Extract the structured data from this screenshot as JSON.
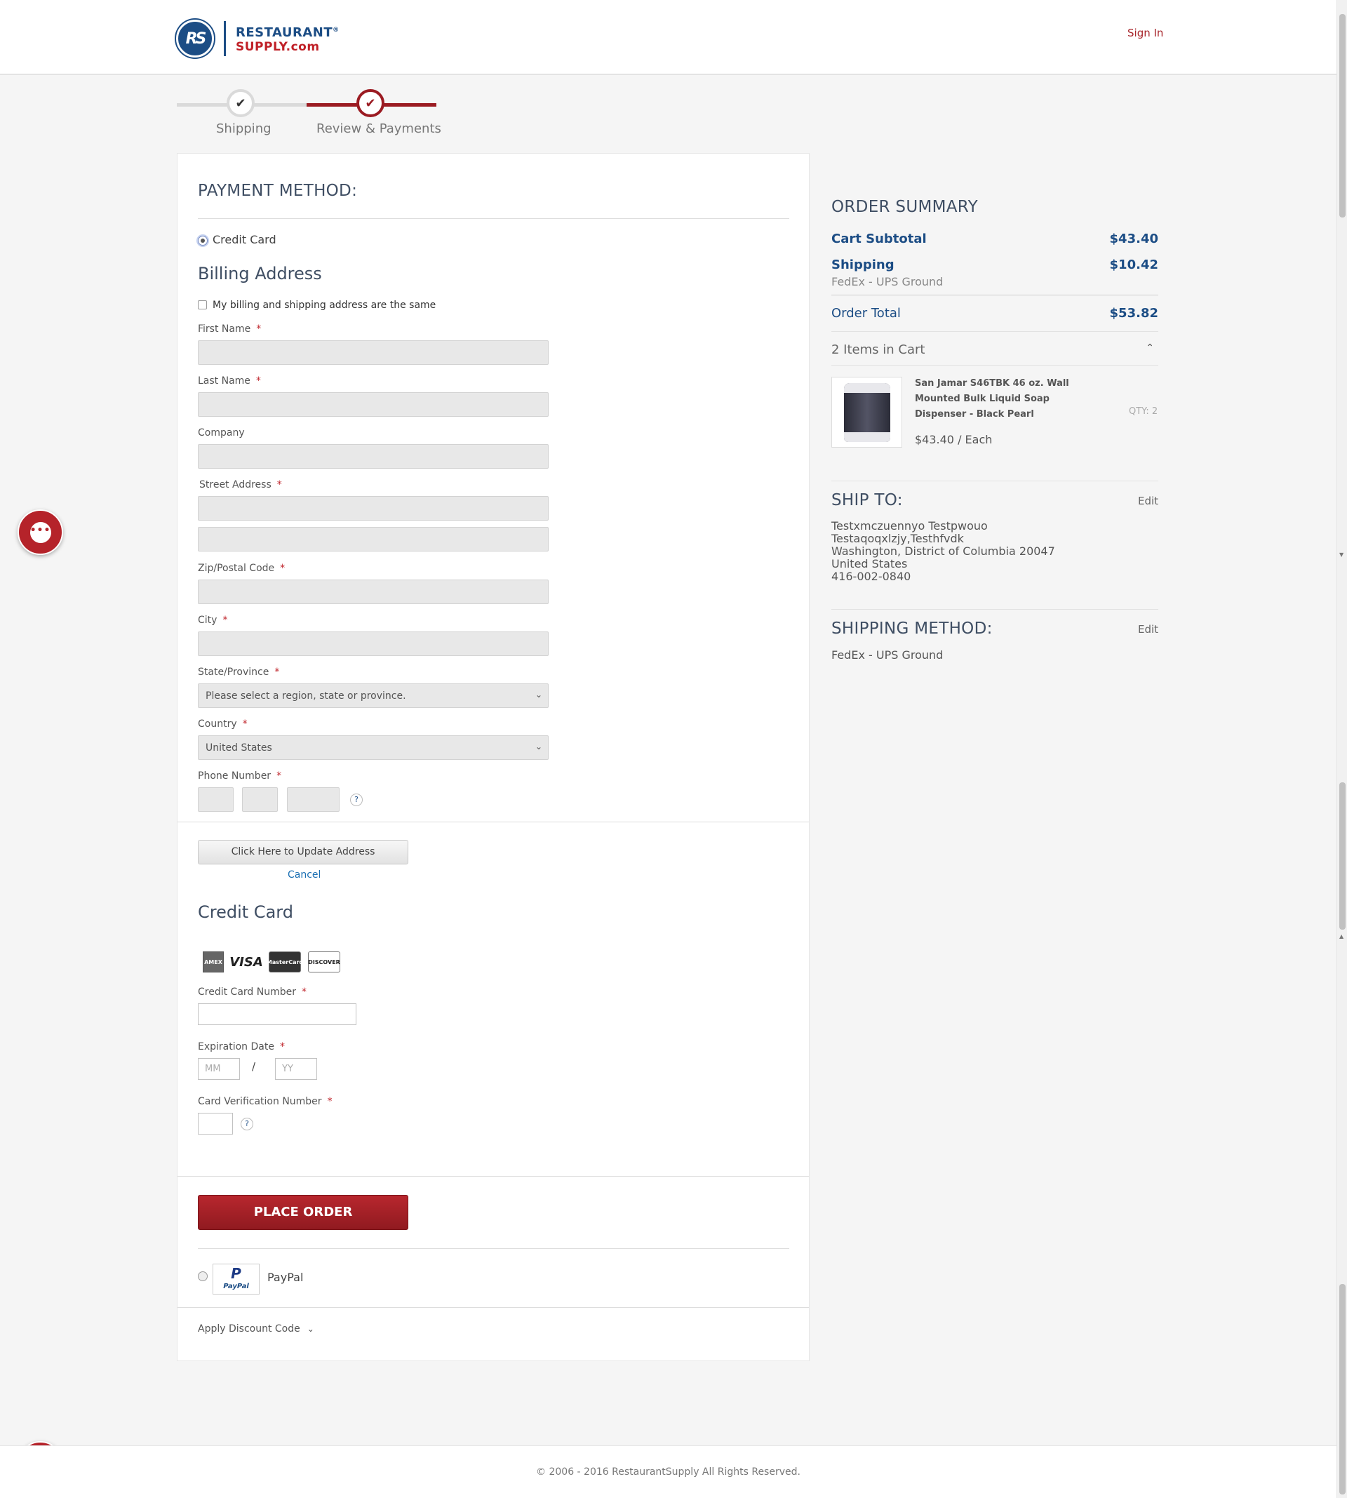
{
  "header": {
    "logo_initials": "RS",
    "logo_line1": "RESTAURANT",
    "logo_reg": "®",
    "logo_line2": "SUPPLY.com",
    "sign_in": "Sign In"
  },
  "progress": {
    "steps": [
      {
        "label": "Shipping",
        "status": "complete"
      },
      {
        "label": "Review & Payments",
        "status": "current"
      }
    ],
    "check_glyph": "✔"
  },
  "payment": {
    "heading": "PAYMENT METHOD:",
    "credit_card_option": "Credit Card",
    "billing_heading": "Billing Address",
    "same_address_label": "My billing and shipping address are the same",
    "fields": {
      "first_name": "First Name",
      "last_name": "Last Name",
      "company": "Company",
      "street": "Street Address",
      "zip": "Zip/Postal Code",
      "city": "City",
      "state": "State/Province",
      "country": "Country",
      "phone": "Phone Number"
    },
    "required_mark": "*",
    "state_value": "Please select a region, state or province.",
    "country_value": "United States",
    "help_glyph": "?",
    "update_button": "Click Here to Update Address",
    "cancel_link": "Cancel",
    "cc_heading": "Credit Card",
    "card_brands": [
      "AMEX",
      "VISA",
      "MasterCard",
      "DISCOVER"
    ],
    "cc_number_label": "Credit Card Number",
    "exp_label": "Expiration Date",
    "exp_month_placeholder": "MM",
    "exp_separator": "/",
    "exp_year_placeholder": "YY",
    "cvv_label": "Card Verification Number",
    "place_order": "PLACE ORDER",
    "paypal_label": "PayPal",
    "paypal_logo_mark": "P",
    "paypal_logo_text": "PayPal",
    "discount_label": "Apply Discount Code"
  },
  "summary": {
    "heading": "ORDER SUMMARY",
    "subtotal_label": "Cart Subtotal",
    "subtotal_value": "$43.40",
    "shipping_label": "Shipping",
    "shipping_value": "$10.42",
    "shipping_carrier": "FedEx - UPS Ground",
    "total_label": "Order Total",
    "total_value": "$53.82",
    "items_count": "2 Items in Cart",
    "item": {
      "name": "San Jamar S46TBK 46 oz. Wall Mounted Bulk Liquid Soap Dispenser - Black Pearl",
      "qty": "QTY: 2",
      "price": "$43.40 / Each"
    }
  },
  "ship_to": {
    "heading": "SHIP TO:",
    "edit": "Edit",
    "lines": [
      "Testxmczuennyo Testpwouo",
      "Testaqoqxlzjy,Testhfvdk",
      "Washington, District of Columbia 20047",
      "United States",
      "416-002-0840"
    ]
  },
  "shipping_method": {
    "heading": "SHIPPING METHOD:",
    "edit": "Edit",
    "value": "FedEx - UPS Ground"
  },
  "chat_glyph": "•••",
  "footer": {
    "copyright": "© 2006 - 2016 RestaurantSupply All Rights Reserved."
  }
}
